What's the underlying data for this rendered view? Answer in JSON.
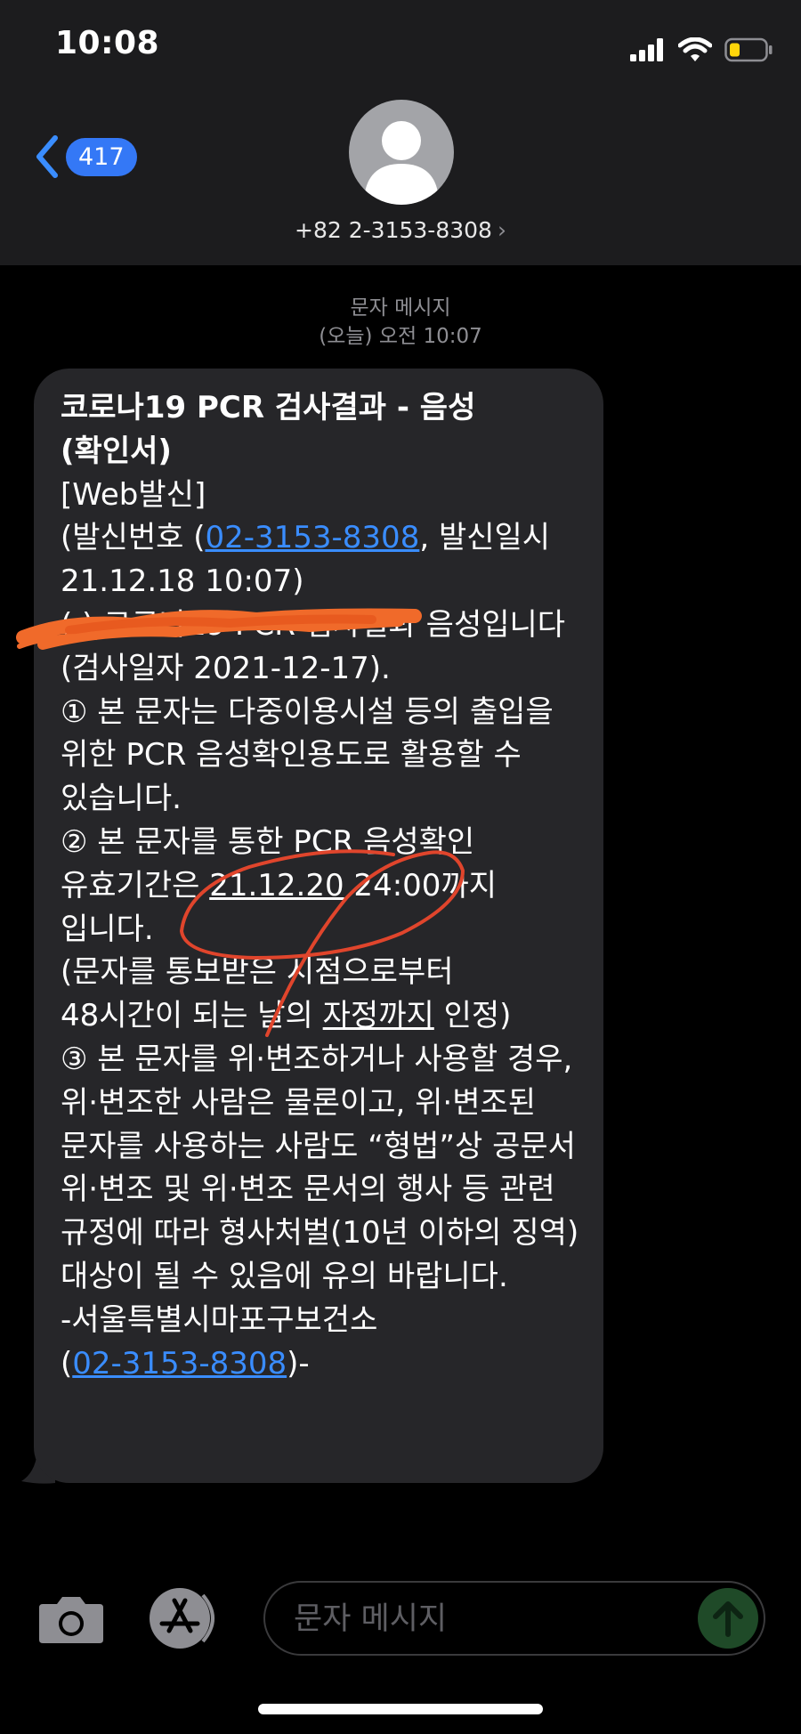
{
  "status_bar": {
    "time": "10:08"
  },
  "header": {
    "back_count": "417",
    "contact_number": "+82 2-3153-8308",
    "chevron": "›"
  },
  "thread": {
    "service_label": "문자 메시지",
    "timestamp": "(오늘) 오전 10:07"
  },
  "message": {
    "title": "코로나19 PCR 검사결과 - 음성(확인서)",
    "web_tag": "[Web발신]",
    "sender_prefix": "(발신번호 (",
    "sender_number": "02-3153-8308",
    "sender_suffix": ", 발신일시 21.12.18 10:07)",
    "result_line": "(                  ) 코로나19 PCR 검사결과 음성입니다(검사일자 2021-12-17).",
    "item1": "① 본 문자는 다중이용시설 등의 출입을 위한 PCR 음성확인용도로 활용할 수 있습니다.",
    "item2_pre": "② 본 문자를 통한 PCR 음성확인 유효기간은 ",
    "item2_date": "21.12.20",
    "item2_post": " 24:00까지 입니다.",
    "note_pre": "(문자를 통보받은 시점으로부터 48시간이 되는 날의 ",
    "note_underlined": "자정까지",
    "note_post": " 인정)",
    "item3": "③ 본 문자를 위·변조하거나 사용할 경우, 위·변조한 사람은 물론이고, 위·변조된 문자를 사용하는 사람도 “형법”상 공문서 위·변조 및 위·변조 문서의 행사 등 관련 규정에 따라 형사처벌(10년 이하의 징역) 대상이 될 수 있음에 유의 바랍니다.",
    "signature": "-서울특별시마포구보건소",
    "footer_open": "(",
    "footer_number": "02-3153-8308",
    "footer_close": ")-"
  },
  "composer": {
    "placeholder": "문자 메시지"
  },
  "colors": {
    "header_bg": "#1c1c1e",
    "bubble_bg": "#262629",
    "link": "#3a8dff",
    "badge": "#3478f6",
    "annotation": "#e0452c",
    "redaction": "#f06a2a",
    "send_button": "#1f4a28"
  },
  "icons": {
    "back": "chevron-left-icon",
    "camera": "camera-icon",
    "app_store": "app-store-icon",
    "send": "arrow-up-icon",
    "battery": "battery-low-icon",
    "wifi": "wifi-icon",
    "signal": "cellular-signal-icon"
  }
}
